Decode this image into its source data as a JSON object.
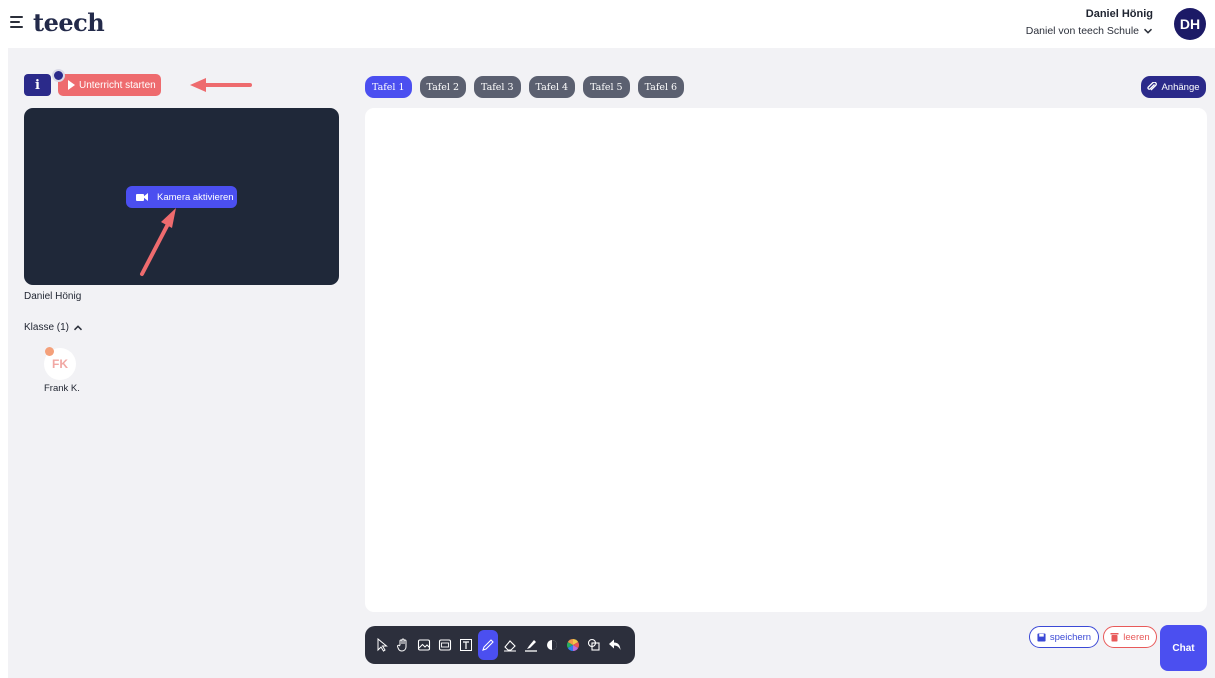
{
  "header": {
    "logo": "teech",
    "user_name": "Daniel Hönig",
    "user_school": "Daniel von teech Schule",
    "avatar_initials": "DH"
  },
  "left_panel": {
    "info_label": "i",
    "start_label": "Unterricht starten",
    "camera_label": "Kamera aktivieren",
    "video_owner": "Daniel Hönig",
    "class_label": "Klasse (1)",
    "student": {
      "initials": "FK",
      "name": "Frank K."
    }
  },
  "board": {
    "tabs": [
      "Tafel 1",
      "Tafel 2",
      "Tafel 3",
      "Tafel 4",
      "Tafel 5",
      "Tafel 6"
    ],
    "active_tab": "Tafel 1",
    "attachments_label": "Anhänge",
    "save_label": "speichern",
    "clear_label": "leeren",
    "chat_label": "Chat"
  },
  "toolbar": {
    "tools": [
      "pointer-icon",
      "hand-icon",
      "image-icon",
      "pdf-icon",
      "text-icon",
      "pencil-icon",
      "eraser-icon",
      "highlighter-icon",
      "fill-icon",
      "color-wheel-icon",
      "shapes-icon",
      "undo-icon"
    ],
    "active_tool": "pencil-icon"
  },
  "colors": {
    "primary": "#4b4ff0",
    "navy": "#2b2a8a",
    "danger": "#ee6b6e",
    "video_bg": "#1f2839"
  }
}
